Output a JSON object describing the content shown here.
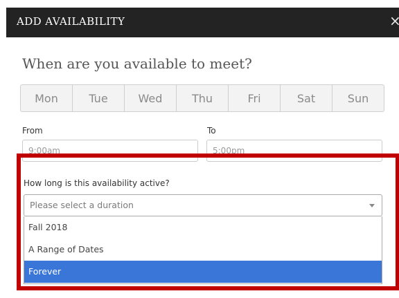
{
  "dialog": {
    "title": "ADD AVAILABILITY",
    "close_glyph": "×"
  },
  "question": "When are you available to meet?",
  "days": [
    "Mon",
    "Tue",
    "Wed",
    "Thu",
    "Fri",
    "Sat",
    "Sun"
  ],
  "time_range": {
    "from_label": "From",
    "to_label": "To",
    "from_value": "9:00am",
    "to_value": "5:00pm"
  },
  "duration": {
    "label": "How long is this availability active?",
    "placeholder": "Please select a duration",
    "options": [
      "Fall 2018",
      "A Range of Dates",
      "Forever"
    ],
    "highlighted_option": "Forever"
  },
  "colors": {
    "header_bg": "#232323",
    "highlight_border": "#c00000",
    "selected_option_bg": "#3a76d8"
  }
}
